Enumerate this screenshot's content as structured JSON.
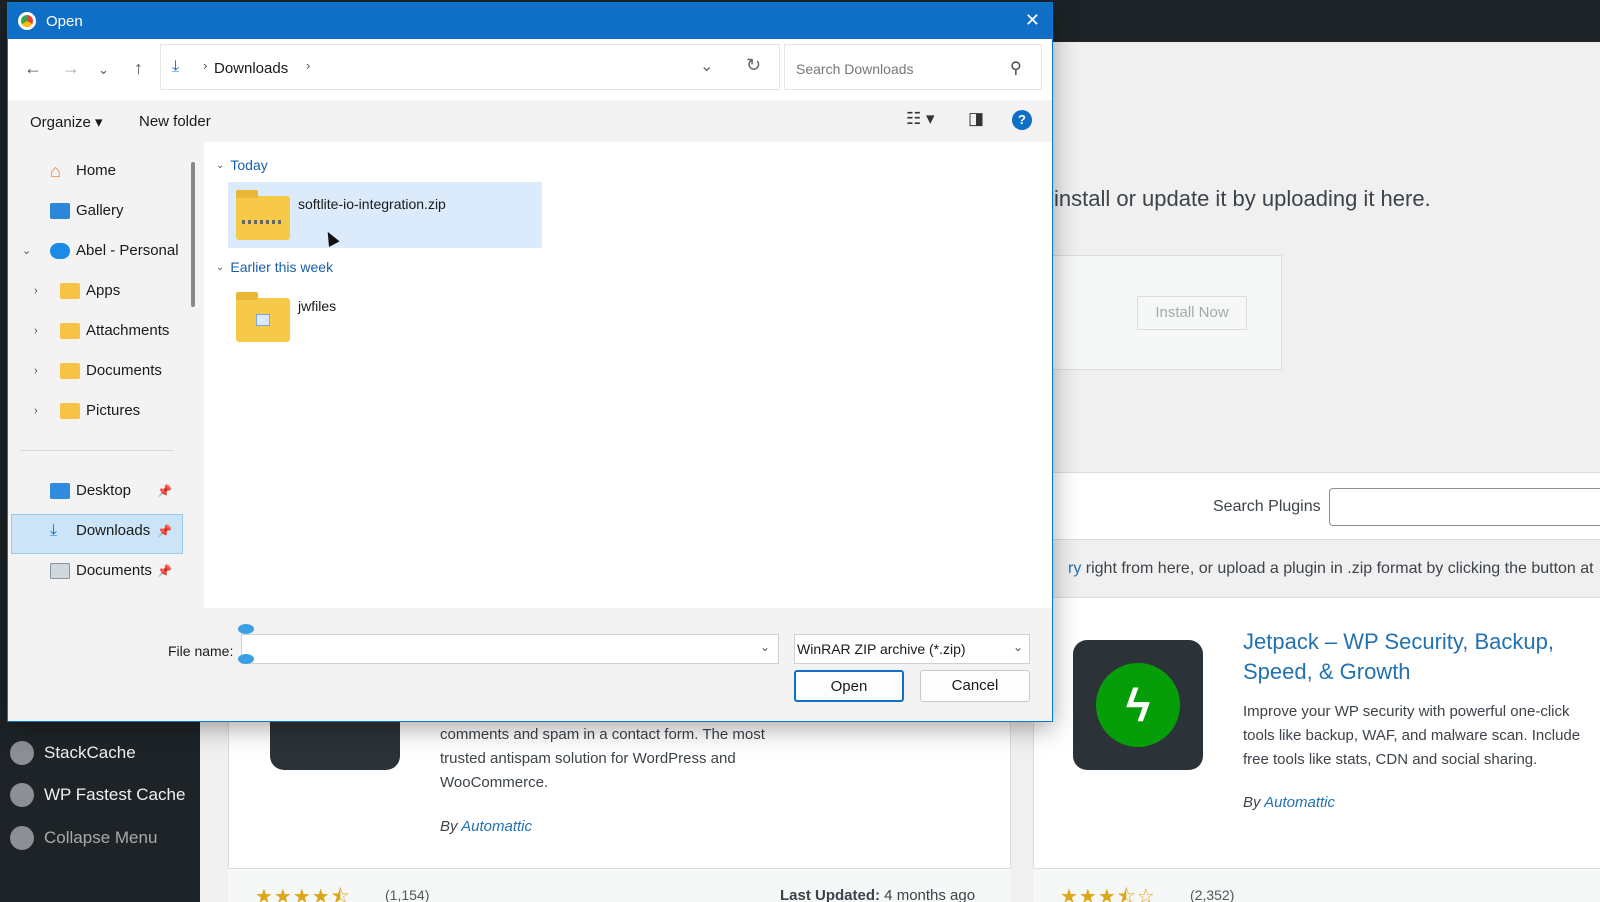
{
  "dialog": {
    "title": "Open",
    "close": "✕",
    "address": {
      "current_folder": "Downloads"
    },
    "search": {
      "placeholder": "Search Downloads"
    },
    "command_bar": {
      "organize_label": "Organize",
      "new_folder_label": "New folder"
    },
    "nav_pane": {
      "items": [
        {
          "label": "Home",
          "icon": "home-icon"
        },
        {
          "label": "Gallery",
          "icon": "gallery-icon"
        },
        {
          "label": "Abel - Personal",
          "icon": "cloud-icon"
        },
        {
          "label": "Apps",
          "icon": "folder-icon"
        },
        {
          "label": "Attachments",
          "icon": "folder-icon"
        },
        {
          "label": "Documents",
          "icon": "folder-icon"
        },
        {
          "label": "Pictures",
          "icon": "folder-icon"
        }
      ],
      "quick_access": [
        {
          "label": "Desktop",
          "icon": "desktop-icon",
          "pinned": true
        },
        {
          "label": "Downloads",
          "icon": "download-icon",
          "pinned": true,
          "selected": true
        },
        {
          "label": "Documents",
          "icon": "documents-icon",
          "pinned": true
        }
      ]
    },
    "file_groups": [
      {
        "header": "Today",
        "files": [
          {
            "name": "softlite-io-integration.zip",
            "type": "zip-folder",
            "selected": true
          }
        ]
      },
      {
        "header": "Earlier this week",
        "files": [
          {
            "name": "jwfiles",
            "type": "folder"
          }
        ]
      }
    ],
    "bottom": {
      "file_name_label": "File name:",
      "file_name_value": "",
      "file_type": "WinRAR ZIP archive (*.zip)",
      "open_label": "Open",
      "cancel_label": "Cancel"
    }
  },
  "background": {
    "sidebar": {
      "stackcache": "StackCache",
      "wp_fastest_cache": "WP Fastest Cache",
      "collapse": "Collapse Menu"
    },
    "upload_text": "install or update it by uploading it here.",
    "install_now": "Install Now",
    "search_plugins_label": "Search Plugins",
    "description_link": "ry",
    "description_text": " right from here, or upload a plugin in .zip format by clicking the button at",
    "card_left": {
      "description": "comments and spam in a contact form. The most trusted antispam solution for WordPress and WooCommerce.",
      "by_prefix": "By ",
      "author": "Automattic",
      "stars": "★★★★⯪",
      "rating_count": "(1,154)",
      "updated_label": "Last Updated:",
      "updated_value": " 4 months ago"
    },
    "card_right": {
      "title": "Jetpack – WP Security, Backup, Speed, & Growth",
      "description_lines": [
        "Improve your WP security with powerful one-click",
        "tools like backup, WAF, and malware scan. Include",
        "free tools like stats, CDN and social sharing."
      ],
      "by_prefix": "By ",
      "author": "Automattic",
      "stars": "★★★⯪☆",
      "rating_count": "(2,352)"
    }
  },
  "colors": {
    "accent": "#0f6fc6",
    "selection": "#cce4f7",
    "wp_link": "#2271b1",
    "wp_dark": "#1d2327"
  }
}
